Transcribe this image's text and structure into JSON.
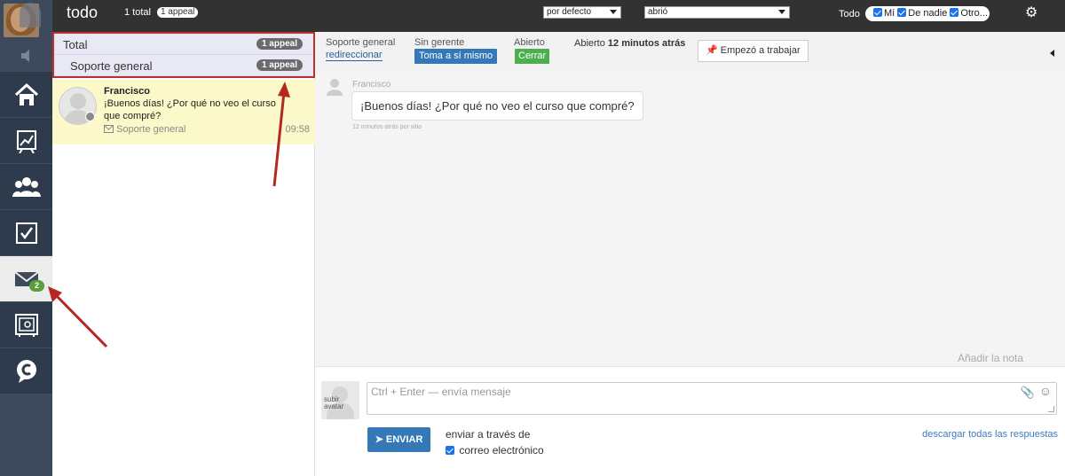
{
  "topbar": {
    "title": "todo",
    "total": "1 total",
    "appeal_badge": "1 appeal",
    "sort_select": "por defecto",
    "status_select": "abrió",
    "filter_label": "Todo",
    "filter_options": [
      "Mí",
      "De nadie",
      "Otro..."
    ]
  },
  "sidebar": {
    "items": [
      "home-icon",
      "chart-icon",
      "users-icon",
      "tasks-icon",
      "mail-icon",
      "safe-icon",
      "chat-logo-icon"
    ],
    "mail_badge": "2"
  },
  "list": {
    "categories": [
      {
        "label": "Total",
        "count": "1 appeal"
      },
      {
        "label": "Soporte general",
        "count": "1 appeal"
      }
    ],
    "conversations": [
      {
        "name": "Francisco",
        "message": "¡Buenos días! ¿Por qué no veo el curso que compré?",
        "source": "Soporte general",
        "time": "09:58"
      }
    ]
  },
  "header": {
    "department_label": "Soporte general",
    "redirect_link": "redireccionar",
    "manager_label": "Sin gerente",
    "take_button": "Toma a sí mismo",
    "status_label": "Abierto",
    "close_button": "Cerrar",
    "opened_prefix": "Abierto",
    "opened_ago": "12 minutos atrás",
    "start_button": "Empezó a trabajar"
  },
  "chat": {
    "messages": [
      {
        "author": "Francisco",
        "text": "¡Buenos días! ¿Por qué no veo el curso que compré?",
        "meta": "12 minutos atrás por sitio"
      }
    ],
    "add_note": "Añadir la nota"
  },
  "compose": {
    "avatar_text": "subir avatar",
    "placeholder": "Ctrl + Enter — envía mensaje",
    "send_button": "ENVIAR",
    "via_label": "enviar a través de",
    "email_option": "correo electrónico",
    "download_link": "descargar todas las respuestas"
  },
  "colors": {
    "sidebar_bg": "#3d4a5c",
    "topbar_bg": "#323232",
    "primary_button": "#3478b8",
    "success_button": "#4cae4c",
    "highlight_box": "#c0302a",
    "conversation_bg": "#fbf9c9",
    "badge_green": "#5a9e3a"
  }
}
